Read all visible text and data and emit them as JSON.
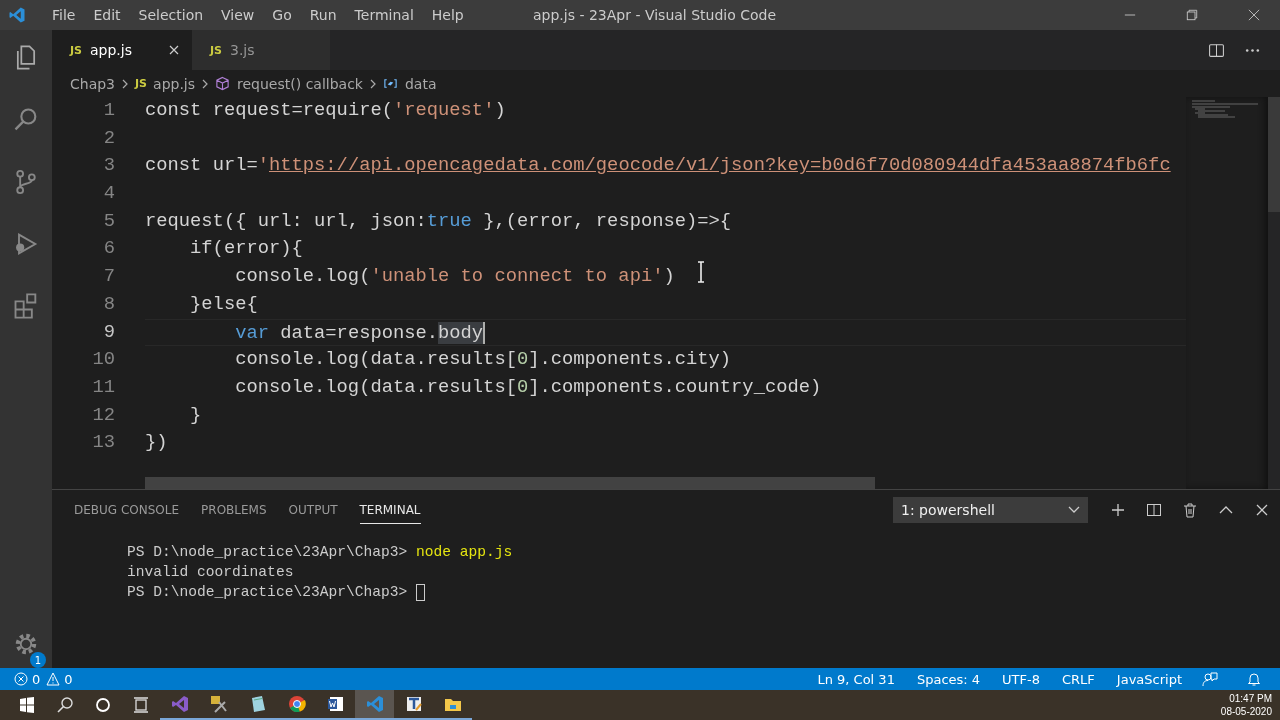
{
  "window": {
    "title": "app.js - 23Apr - Visual Studio Code"
  },
  "menu": [
    "File",
    "Edit",
    "Selection",
    "View",
    "Go",
    "Run",
    "Terminal",
    "Help"
  ],
  "activity_bar": {
    "settings_badge": "1"
  },
  "tabs": [
    {
      "label": "app.js",
      "icon_text": "JS",
      "selected": true
    },
    {
      "label": "3.js",
      "icon_text": "JS",
      "selected": false
    }
  ],
  "breadcrumbs": [
    {
      "label": "Chap3",
      "kind": "folder"
    },
    {
      "label": "app.js",
      "kind": "file",
      "icon_text": "JS"
    },
    {
      "label": "request() callback",
      "kind": "method"
    },
    {
      "label": "data",
      "kind": "variable"
    }
  ],
  "editor": {
    "lines": [
      {
        "number": "1",
        "current": false,
        "tokens": [
          {
            "t": "const",
            "kind": "kw"
          },
          {
            "t": " request=require(",
            "kind": "plain"
          },
          {
            "t": "'request'",
            "kind": "str"
          },
          {
            "t": ")",
            "kind": "plain"
          }
        ]
      },
      {
        "number": "2",
        "current": false
      },
      {
        "number": "3",
        "current": false,
        "tokens": [
          {
            "t": "const",
            "kind": "kw"
          },
          {
            "t": " url=",
            "kind": "plain"
          },
          {
            "t": "'",
            "kind": "str"
          },
          {
            "t": "https://api.opencagedata.com/geocode/v1/json?key=b0d6f70d080944dfa453aa8874fb6fc",
            "kind": "link"
          }
        ]
      },
      {
        "number": "4",
        "current": false
      },
      {
        "number": "5",
        "current": false,
        "tokens": [
          {
            "t": "request({ url: url, json:",
            "kind": "plain"
          },
          {
            "t": "true",
            "kind": "bool"
          },
          {
            "t": " },(error, response)=>{",
            "kind": "plain"
          }
        ]
      },
      {
        "number": "6",
        "current": false,
        "tokens": [
          {
            "t": "    if(error){",
            "kind": "plain"
          }
        ]
      },
      {
        "number": "7",
        "current": false,
        "tokens": [
          {
            "t": "        console.log(",
            "kind": "plain"
          },
          {
            "t": "'unable to connect to api'",
            "kind": "str"
          },
          {
            "t": ")",
            "kind": "plain"
          }
        ]
      },
      {
        "number": "8",
        "current": false,
        "tokens": [
          {
            "t": "    }else{",
            "kind": "plain"
          }
        ]
      },
      {
        "number": "9",
        "current": true,
        "tokens": [
          {
            "t": "        var",
            "kind": "bool"
          },
          {
            "t": " data=response.",
            "kind": "plain"
          },
          {
            "t": "body",
            "kind": "match"
          }
        ]
      },
      {
        "number": "10",
        "current": false,
        "tokens": [
          {
            "t": "        console.log(data.results[",
            "kind": "plain"
          },
          {
            "t": "0",
            "kind": "num"
          },
          {
            "t": "].components.city)",
            "kind": "plain"
          }
        ]
      },
      {
        "number": "11",
        "current": false,
        "tokens": [
          {
            "t": "        console.log(data.results[",
            "kind": "plain"
          },
          {
            "t": "0",
            "kind": "num"
          },
          {
            "t": "].components.country_code)",
            "kind": "plain"
          }
        ]
      },
      {
        "number": "12",
        "current": false,
        "tokens": [
          {
            "t": "    }",
            "kind": "plain"
          }
        ]
      },
      {
        "number": "13",
        "current": false,
        "tokens": [
          {
            "t": "})",
            "kind": "plain"
          }
        ]
      }
    ]
  },
  "panel": {
    "tabs": [
      {
        "label": "DEBUG CONSOLE",
        "selected": false
      },
      {
        "label": "PROBLEMS",
        "selected": false
      },
      {
        "label": "OUTPUT",
        "selected": false
      },
      {
        "label": "TERMINAL",
        "selected": true
      }
    ],
    "terminal_select": "1: powershell",
    "lines": [
      {
        "kind": "prompt",
        "prompt": "PS D:\\node_practice\\23Apr\\Chap3> ",
        "command": "node app.js"
      },
      {
        "kind": "output",
        "text": "invalid coordinates"
      },
      {
        "kind": "prompt",
        "prompt": "PS D:\\node_practice\\23Apr\\Chap3> "
      }
    ]
  },
  "status_bar": {
    "errors": "0",
    "warnings": "0",
    "items": [
      "Ln 9, Col 31",
      "Spaces: 4",
      "UTF-8",
      "CRLF",
      "JavaScript"
    ]
  },
  "taskbar": {
    "apps": [
      {
        "kind": "vs",
        "selected": false
      },
      {
        "kind": "tools",
        "selected": false
      },
      {
        "kind": "notepad",
        "selected": false
      },
      {
        "kind": "chrome",
        "selected": false
      },
      {
        "kind": "word",
        "selected": false
      },
      {
        "kind": "vscode",
        "selected": true
      },
      {
        "kind": "editor",
        "selected": false
      },
      {
        "kind": "folder",
        "selected": false
      }
    ],
    "time": "01:47 PM",
    "date": "08-05-2020"
  }
}
